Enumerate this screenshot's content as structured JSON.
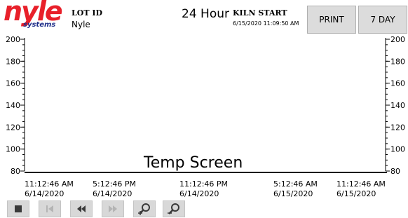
{
  "header": {
    "logo_text": "nyle",
    "logo_subtext": "systems",
    "lot_label": "LOT ID",
    "lot_value": "Nyle",
    "range_title": "24 Hour",
    "kiln_label": "KILN START",
    "kiln_value": "6/15/2020 11:09:50 AM",
    "print_label": "PRINT",
    "seven_day_label": "7 DAY"
  },
  "chart_data": {
    "type": "line",
    "ylim": [
      80,
      200
    ],
    "y_ticks": [
      "200",
      "180",
      "160",
      "140",
      "120",
      "100",
      "80"
    ],
    "x_labels": [
      {
        "time": "11:12:46 AM",
        "date": "6/14/2020"
      },
      {
        "time": "5:12:46 PM",
        "date": "6/14/2020"
      },
      {
        "time": "11:12:46 PM",
        "date": "6/14/2020"
      },
      {
        "time": "5:12:46 AM",
        "date": "6/15/2020"
      },
      {
        "time": "11:12:46 AM",
        "date": "6/15/2020"
      }
    ],
    "series": [],
    "watermark": "Temp Screen"
  },
  "toolbar": {
    "buttons": [
      {
        "name": "stop-icon",
        "enabled": true
      },
      {
        "name": "skip-back-icon",
        "enabled": false
      },
      {
        "name": "rewind-icon",
        "enabled": true
      },
      {
        "name": "fast-forward-icon",
        "enabled": false
      },
      {
        "name": "zoom-in-icon",
        "enabled": true
      },
      {
        "name": "zoom-out-icon",
        "enabled": true
      }
    ]
  },
  "colors": {
    "brand_red": "#e8202a",
    "brand_blue": "#1f2f8a",
    "button_gray": "#dcdcdc",
    "icon_dark": "#3a3a3a",
    "icon_disabled": "#b4b4b4"
  }
}
